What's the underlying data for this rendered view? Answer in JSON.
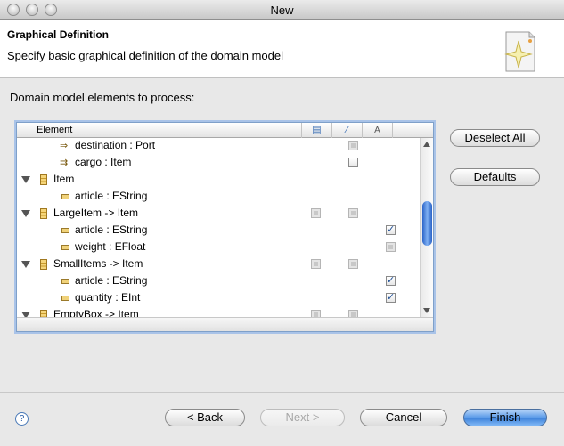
{
  "window": {
    "title": "New"
  },
  "banner": {
    "title": "Graphical Definition",
    "description": "Specify basic graphical definition of the domain model"
  },
  "content": {
    "label": "Domain model elements to process:"
  },
  "tree": {
    "columns": [
      {
        "label": "Element",
        "icon": "element-column-header"
      },
      {
        "label": "",
        "icon": "node-icon"
      },
      {
        "label": "",
        "icon": "link-icon"
      },
      {
        "label": "A",
        "icon": "label-icon"
      }
    ],
    "rows": [
      {
        "label": "destination : Port",
        "level": 2,
        "icon": "reference-icon",
        "expanded": null,
        "checks": [
          null,
          "disabled",
          null
        ]
      },
      {
        "label": "cargo : Item",
        "level": 2,
        "icon": "containment-reference-icon",
        "expanded": null,
        "checks": [
          null,
          "unchecked",
          null
        ]
      },
      {
        "label": "Item",
        "level": 1,
        "icon": "class-icon",
        "expanded": true,
        "checks": [
          null,
          null,
          null
        ]
      },
      {
        "label": "article : EString",
        "level": 2,
        "icon": "attribute-icon",
        "expanded": null,
        "checks": [
          null,
          null,
          null
        ]
      },
      {
        "label": "LargeItem -> Item",
        "level": 1,
        "icon": "class-icon",
        "expanded": true,
        "checks": [
          "disabled",
          "disabled",
          null
        ]
      },
      {
        "label": "article : EString",
        "level": 2,
        "icon": "attribute-icon",
        "expanded": null,
        "checks": [
          null,
          null,
          "checked"
        ]
      },
      {
        "label": "weight : EFloat",
        "level": 2,
        "icon": "attribute-icon",
        "expanded": null,
        "checks": [
          null,
          null,
          "disabled"
        ]
      },
      {
        "label": "SmallItems -> Item",
        "level": 1,
        "icon": "class-icon",
        "expanded": true,
        "checks": [
          "disabled",
          "disabled",
          null
        ]
      },
      {
        "label": "article : EString",
        "level": 2,
        "icon": "attribute-icon",
        "expanded": null,
        "checks": [
          null,
          null,
          "checked"
        ]
      },
      {
        "label": "quantity : EInt",
        "level": 2,
        "icon": "attribute-icon",
        "expanded": null,
        "checks": [
          null,
          null,
          "checked"
        ]
      },
      {
        "label": "EmptyBox -> Item",
        "level": 1,
        "icon": "class-icon",
        "expanded": true,
        "checks": [
          "disabled",
          "disabled",
          null
        ]
      }
    ]
  },
  "side_buttons": {
    "deselect_all": "Deselect All",
    "defaults": "Defaults"
  },
  "footer": {
    "help": "?",
    "back": "< Back",
    "next": "Next >",
    "cancel": "Cancel",
    "finish": "Finish"
  }
}
